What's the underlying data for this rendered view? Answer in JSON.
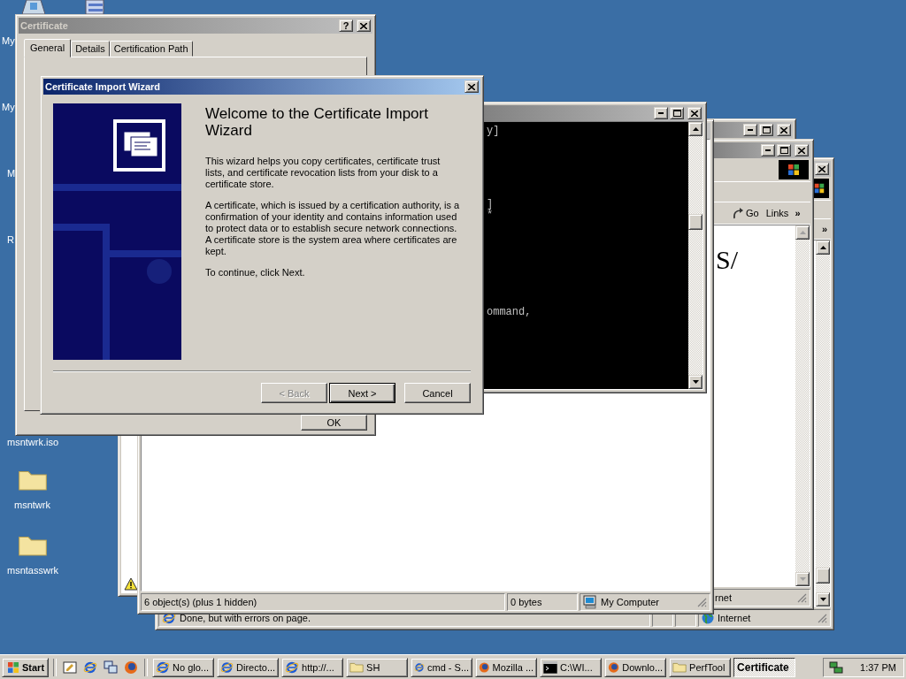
{
  "desktop_icons": [
    {
      "label": "My",
      "kind": "computer"
    },
    {
      "kind": "stack"
    },
    {
      "label": "My",
      "kind": "covered"
    },
    {
      "label": "M",
      "kind": "covered"
    },
    {
      "label": "R",
      "kind": "covered"
    },
    {
      "label": "msntwrk.iso",
      "kind": "covered"
    },
    {
      "label": "msntwrk",
      "kind": "folder"
    },
    {
      "label": "msntasswrk",
      "kind": "folder"
    }
  ],
  "browser_back": {
    "chevron": "»",
    "status": "Done, but with errors on page.",
    "zone": "Internet"
  },
  "browser_front": {
    "go": "Go",
    "links": "Links",
    "chevron": "»",
    "page_text": "S/",
    "zone": "rnet"
  },
  "explorer": {
    "status": [
      "6 object(s) (plus 1 hidden)",
      "0 bytes",
      "My Computer"
    ]
  },
  "console": {
    "lines": [
      "y]",
      "]",
      "*",
      "ommand,"
    ]
  },
  "certificate_dialog": {
    "title": "Certificate",
    "active": false,
    "help": "?",
    "tabs": [
      {
        "label": "General",
        "selected": true
      },
      {
        "label": "Details",
        "selected": false
      },
      {
        "label": "Certification Path",
        "selected": false
      }
    ],
    "ok": "OK"
  },
  "wizard": {
    "title": "Certificate Import Wizard",
    "active": true,
    "heading": "Welcome to the Certificate Import Wizard",
    "paragraphs": [
      "This wizard helps you copy certificates, certificate trust lists, and certificate revocation lists from your disk to a certificate store.",
      "A certificate, which is issued by a certification authority, is a confirmation of your identity and contains information used to protect data or to establish secure network connections. A certificate store is the system area where certificates are kept.",
      "To continue, click Next."
    ],
    "buttons": [
      {
        "label": "< Back",
        "disabled": true,
        "default": false
      },
      {
        "label": "Next >",
        "disabled": false,
        "default": true
      },
      {
        "label": "Cancel",
        "disabled": false,
        "default": false
      }
    ]
  },
  "taskbar": {
    "start": "Start",
    "tasks": [
      {
        "label": "No glo...",
        "kind": "ie",
        "selected": false
      },
      {
        "label": "Directo...",
        "kind": "ie",
        "selected": false
      },
      {
        "label": "http://...",
        "kind": "ie",
        "selected": false
      },
      {
        "label": "SH",
        "kind": "folder",
        "selected": false
      },
      {
        "label": "cmd - S...",
        "kind": "ie",
        "selected": false
      },
      {
        "label": "Mozilla ...",
        "kind": "firefox",
        "selected": false
      },
      {
        "label": "C:\\WI...",
        "kind": "console",
        "selected": false
      },
      {
        "label": "Downlo...",
        "kind": "firefox",
        "selected": false
      },
      {
        "label": "PerfTool",
        "kind": "folder",
        "selected": false
      },
      {
        "label": "Certificate",
        "kind": "none",
        "selected": true
      }
    ],
    "clock": "1:37 PM"
  }
}
